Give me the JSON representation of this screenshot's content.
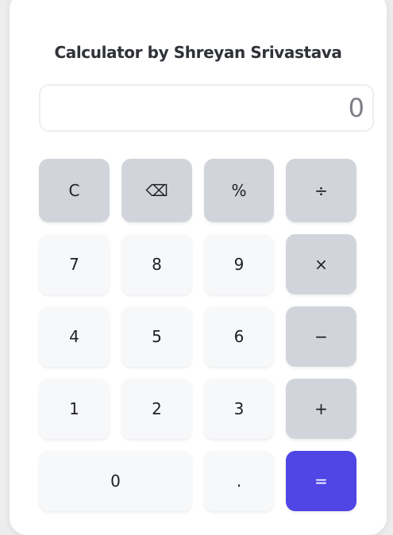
{
  "app": {
    "title": "Calculator by Shreyan Srivastava"
  },
  "display": {
    "value": "0"
  },
  "keys": {
    "clear": "C",
    "backspace": "⌫",
    "percent": "%",
    "divide": "÷",
    "seven": "7",
    "eight": "8",
    "nine": "9",
    "multiply": "×",
    "four": "4",
    "five": "5",
    "six": "6",
    "subtract": "−",
    "one": "1",
    "two": "2",
    "three": "3",
    "add": "+",
    "zero": "0",
    "decimal": ".",
    "equals": "="
  },
  "colors": {
    "accent": "#4f46e5",
    "function_key": "#d1d5db",
    "number_key": "#f7f8fa"
  }
}
